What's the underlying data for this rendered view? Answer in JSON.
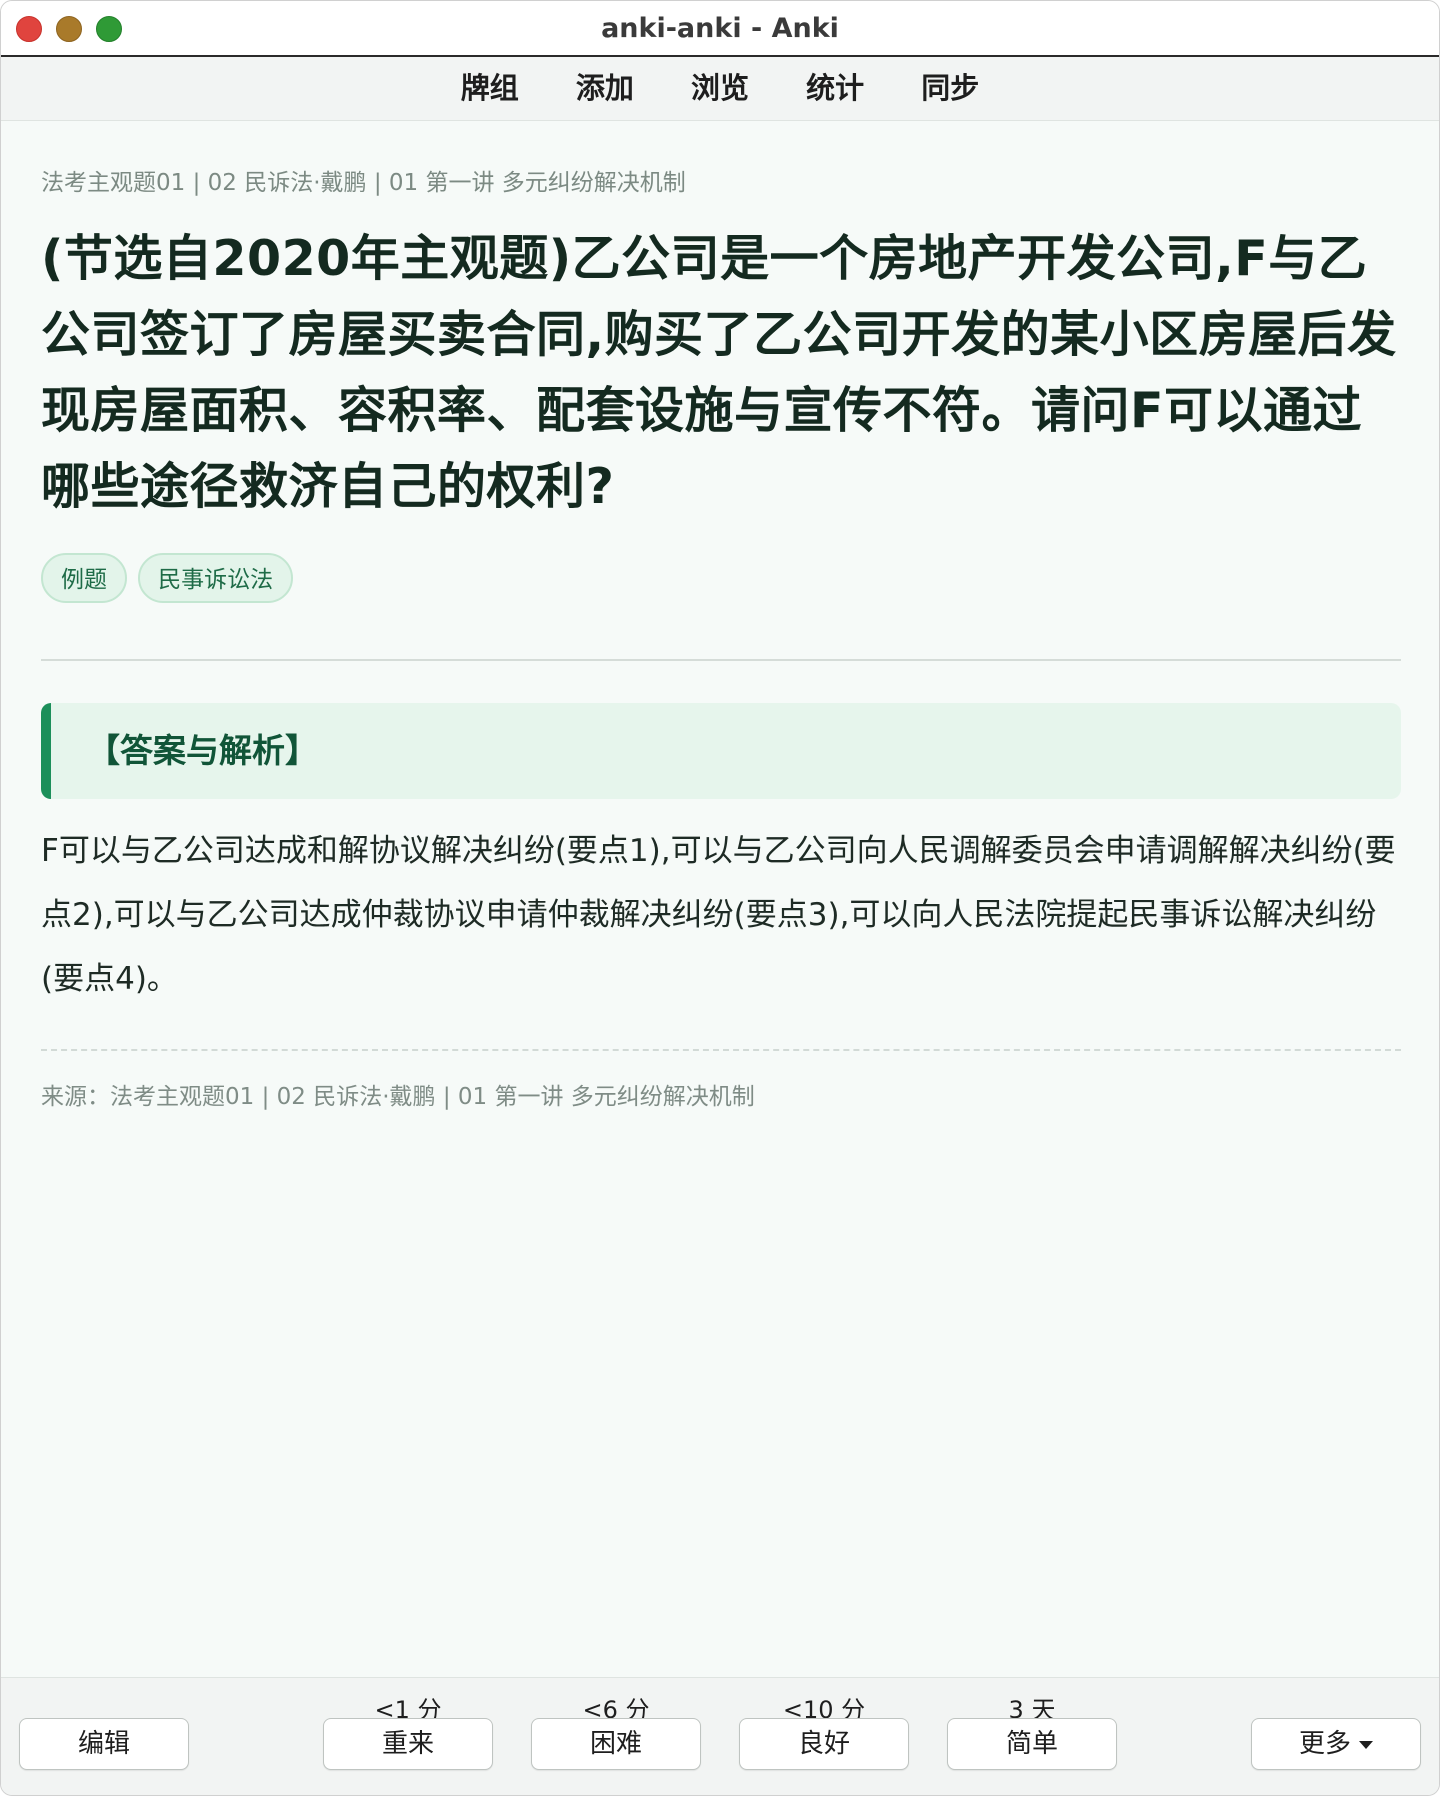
{
  "window": {
    "title": "anki-anki - Anki"
  },
  "menu": {
    "items": [
      "牌组",
      "添加",
      "浏览",
      "统计",
      "同步"
    ]
  },
  "card": {
    "breadcrumb": "法考主观题01 | 02 民诉法·戴鹏 | 01 第一讲 多元纠纷解决机制",
    "question": "(节选自2020年主观题)乙公司是一个房地产开发公司,F与乙公司签订了房屋买卖合同,购买了乙公司开发的某小区房屋后发现房屋面积、容积率、配套设施与宣传不符。请问F可以通过哪些途径救济自己的权利?",
    "tags": [
      "例题",
      "民事诉讼法"
    ],
    "answer_header": "【答案与解析】",
    "answer_text": "F可以与乙公司达成和解协议解决纠纷(要点1),可以与乙公司向人民调解委员会申请调解解决纠纷(要点2),可以与乙公司达成仲裁协议申请仲裁解决纠纷(要点3),可以向人民法院提起民事诉讼解决纠纷(要点4)。",
    "source": "来源：法考主观题01 | 02 民诉法·戴鹏 | 01 第一讲 多元纠纷解决机制"
  },
  "bottom": {
    "edit_label": "编辑",
    "more_label": "更多",
    "answers": [
      {
        "interval": "<1 分",
        "label": "重来"
      },
      {
        "interval": "<6 分",
        "label": "困难"
      },
      {
        "interval": "<10 分",
        "label": "良好"
      },
      {
        "interval": "3 天",
        "label": "简单"
      }
    ]
  },
  "colors": {
    "accent": "#1c8f5a",
    "tag_bg": "#e3f4ea",
    "page_bg": "#f6faf8"
  }
}
